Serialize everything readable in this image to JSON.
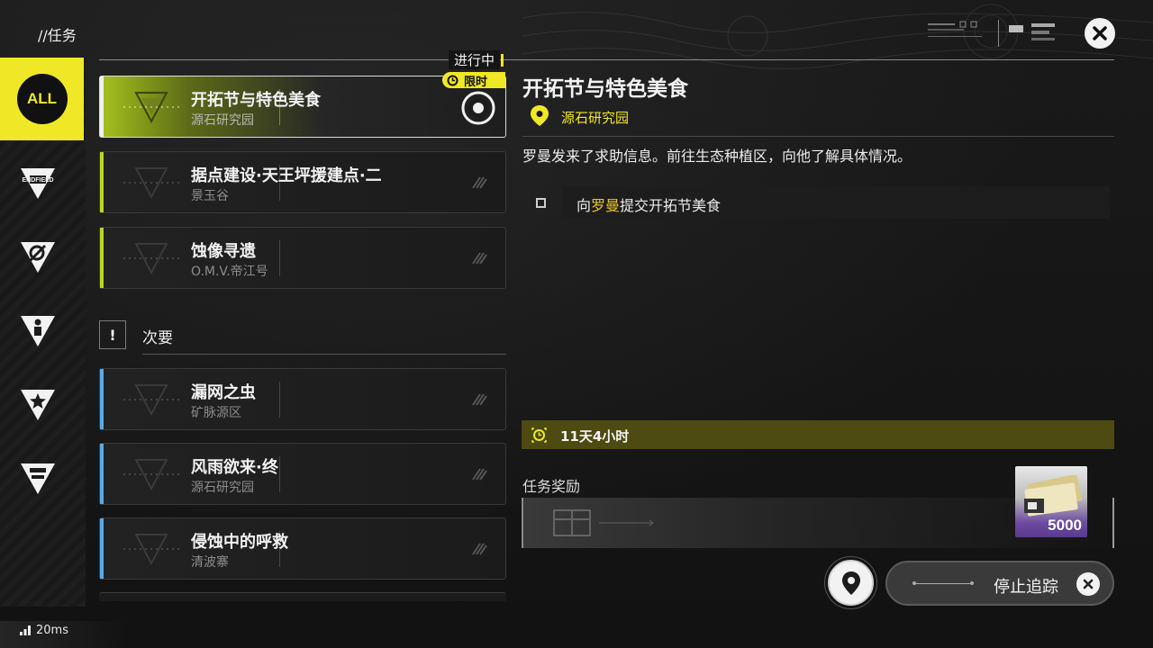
{
  "header": {
    "title": "//任务",
    "logo_text": "ENDFIELD"
  },
  "rail": {
    "items": [
      {
        "label": "ALL",
        "icon": "all-icon",
        "active": true
      },
      {
        "label": "ENDFIELD",
        "icon": "endfield-icon"
      },
      {
        "label": "",
        "icon": "compass-icon"
      },
      {
        "label": "",
        "icon": "person-icon"
      },
      {
        "label": "",
        "icon": "star-icon"
      },
      {
        "label": "",
        "icon": "factory-icon"
      }
    ]
  },
  "main_quests": {
    "section_label": "进行中",
    "limited_badge": "限时",
    "items": [
      {
        "title": "开拓节与特色美食",
        "location": "源石研究园",
        "selected": true
      },
      {
        "title": "据点建设·天王坪援建点·二",
        "location": "景玉谷"
      },
      {
        "title": "蚀像寻遗",
        "location": "O.M.V.帝江号"
      }
    ]
  },
  "secondary": {
    "badge": "!",
    "label": "次要",
    "items": [
      {
        "title": "漏网之虫",
        "location": "矿脉源区"
      },
      {
        "title": "风雨欲来·终",
        "location": "源石研究园"
      },
      {
        "title": "侵蚀中的呼救",
        "location": "清波寨"
      }
    ]
  },
  "detail": {
    "title": "开拓节与特色美食",
    "location": "源石研究园",
    "description": "罗曼发来了求助信息。前往生态种植区，向他了解具体情况。",
    "objective_prefix": "向",
    "objective_highlight": "罗曼",
    "objective_suffix": "提交开拓节美食",
    "timer": "11天4小时",
    "reward_label": "任务奖励",
    "reward_qty": "5000"
  },
  "actions": {
    "stop_tracking": "停止追踪"
  },
  "status": {
    "ping": "20ms"
  },
  "colors": {
    "accent": "#f0e826",
    "main_stripe": "#b6d629",
    "secondary_stripe": "#5aa9e6",
    "highlight_text": "#f0c826"
  }
}
